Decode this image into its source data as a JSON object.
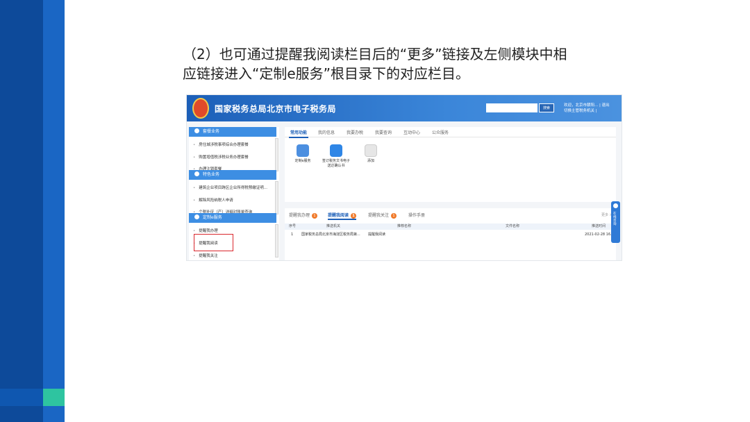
{
  "caption": {
    "line1": "（2）也可通过提醒我阅读栏目后的“更多”链接及左侧模块中相",
    "line2": "应链接进入“定制e服务”根目录下的对应栏目。"
  },
  "colors": {
    "slide_dark": "#0d4a9a",
    "slide_mid": "#1a66c4",
    "accent": "#2ec4a0",
    "header_blue": "#1c5fb8",
    "highlight_red": "#d9262c"
  },
  "header": {
    "title": "国家税务总局北京市电子税务局",
    "search_placeholder": "",
    "search_button": "搜索",
    "welcome_line1": "欢迎，北京市朝阳... | 退出",
    "welcome_line2": "切换主管税务机关 |"
  },
  "sidebar": {
    "sections": [
      {
        "title": "套餐业务",
        "icon": "package-icon",
        "items": [
          "房住城涉税事项综合办理套餐",
          "购置增值税涉税业务办理套餐",
          "办理注销套餐"
        ]
      },
      {
        "title": "特色业务",
        "icon": "star-icon",
        "items": [
          "建筑企业项目跨区企业所得税预缴证明...",
          "解除风险纳税人申请",
          "个税补征（产）详细对账单查询"
        ]
      },
      {
        "title": "定制e服务",
        "icon": "user-icon",
        "items": [
          "提醒我办理",
          "提醒我阅读",
          "提醒我关注"
        ]
      }
    ]
  },
  "main": {
    "tabs": [
      "常用功能",
      "我的信息",
      "我要办税",
      "我要查询",
      "互动中心",
      "公众服务"
    ],
    "apps": [
      {
        "label": "定制e服务",
        "icon": "person-icon"
      },
      {
        "label": "签订税务文书电子送达确认书",
        "icon": "check-icon"
      },
      {
        "label": "添加",
        "icon": "add-icon"
      }
    ]
  },
  "lower": {
    "tabs": [
      {
        "label": "提醒我办理",
        "badge": "1"
      },
      {
        "label": "提醒我阅读",
        "badge": "1"
      },
      {
        "label": "提醒我关注",
        "badge": "1"
      },
      {
        "label": "操作手册",
        "badge": ""
      }
    ],
    "more": "更多 >",
    "headers": [
      "序号",
      "推送机关",
      "推荐名称",
      "文件名称",
      "推送时间"
    ],
    "rows": [
      [
        "1",
        "国家税务总局北京市海淀区税务局第...",
        "提醒我阅读",
        "",
        "2021-02-28 16..."
      ]
    ]
  },
  "float_widget": {
    "text": "在线咨询"
  }
}
